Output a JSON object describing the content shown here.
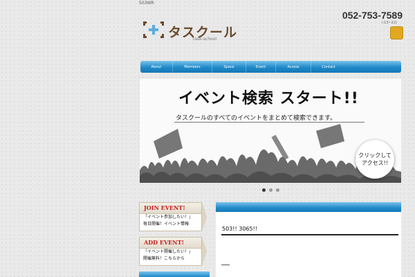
{
  "top_note": "503WR",
  "logo": {
    "text": "タスクール",
    "sub": "task-school"
  },
  "contact": {
    "phone": "052-753-7589",
    "hours": "(:13~22)"
  },
  "nav": {
    "items": [
      "About",
      "Members",
      "Space",
      "Event",
      "Access",
      "Contact"
    ]
  },
  "banner": {
    "title": "イベント検索 スタート!!",
    "subtitle": "タスクールのすべてのイベントをまとめて検索できます。",
    "access_line1": "クリックして",
    "access_line2": "アクセス!!"
  },
  "slider": {
    "count": 3,
    "active": 0
  },
  "side": {
    "join": {
      "title": "JOIN EVENT!",
      "line1": "「イベント参加したい！」",
      "line2": "毎日開催！イベント情報"
    },
    "add": {
      "title": "ADD EVENT!",
      "line1": "「イベント開催したい！」",
      "line2": "開催無料！こちらから"
    }
  },
  "content": {
    "text": "503!! 3065!!"
  },
  "colors": {
    "accent_blue": "#1f89c8",
    "brand_brown": "#6b4a2b",
    "join_red": "#c21d1d",
    "badge_gold": "#e1a820"
  }
}
